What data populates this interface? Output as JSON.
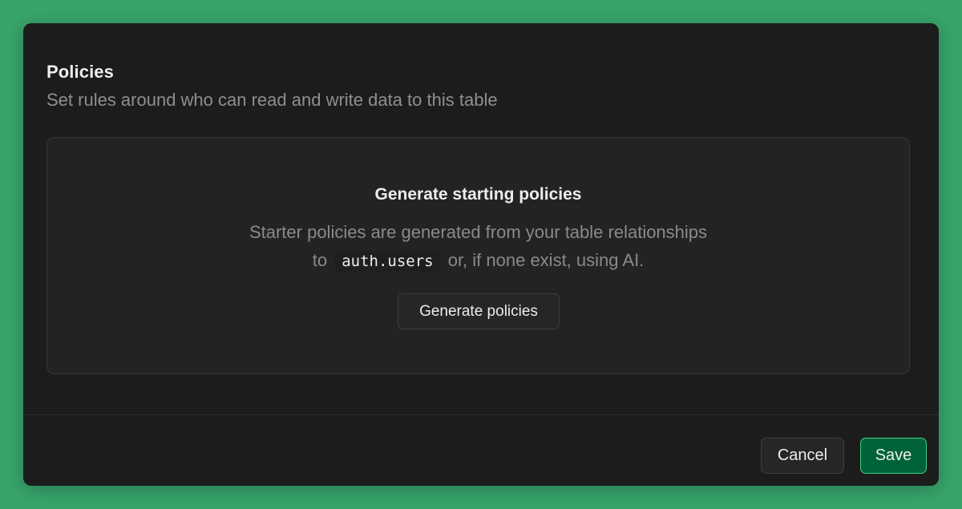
{
  "policies": {
    "title": "Policies",
    "subtitle": "Set rules around who can read and write data to this table"
  },
  "empty_state": {
    "title": "Generate starting policies",
    "line1": "Starter policies are generated from your table relationships",
    "line2_prefix": "to",
    "line2_code": "auth.users",
    "line2_suffix": "or, if none exist, using AI.",
    "button_label": "Generate policies"
  },
  "footer": {
    "cancel_label": "Cancel",
    "save_label": "Save"
  },
  "colors": {
    "background": "#38a46b",
    "panel": "#1c1c1c",
    "card": "#232323",
    "save_button": "#006239",
    "save_border": "#3ecf8e"
  }
}
